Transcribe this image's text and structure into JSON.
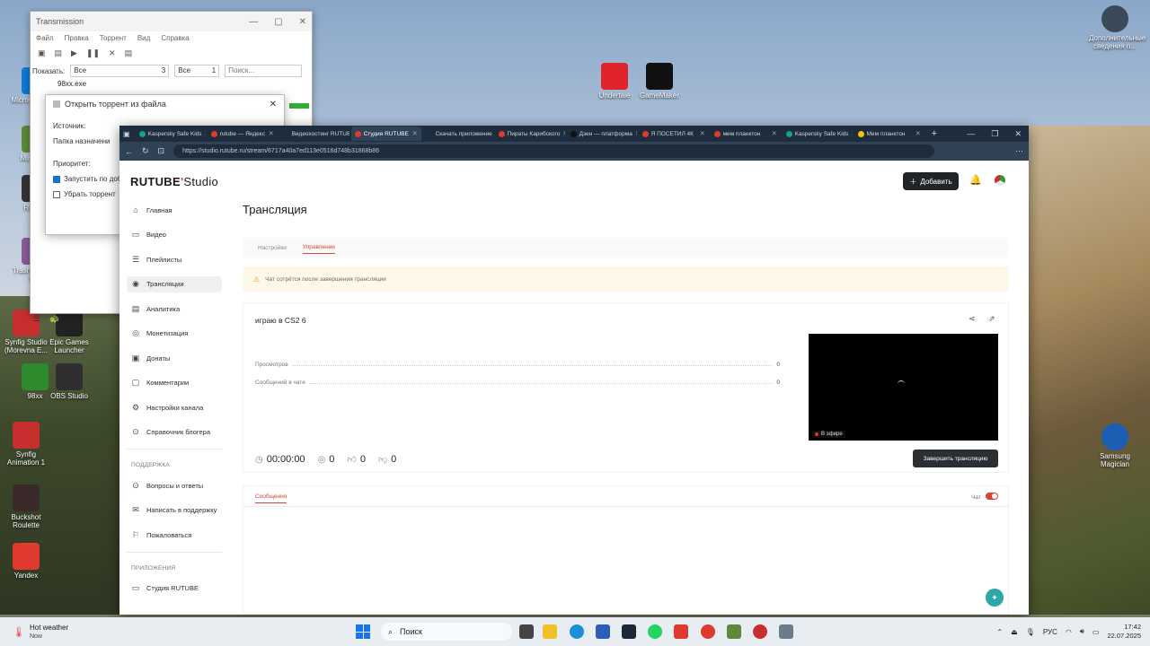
{
  "desktop": {
    "icons_left": [
      {
        "label": "Microsoft Edge",
        "color": "#0c7bd6"
      },
      {
        "label": "Minecraft",
        "color": "#5c8a3a"
      },
      {
        "label": "Roblox",
        "color": "#333333"
      },
      {
        "label": "Trashmatic Of Life",
        "color": "#8a5a9a"
      },
      {
        "label": "Synfig Studio (Morevna E...",
        "color": "#c72f2f"
      },
      {
        "label": "Epic Games Launcher",
        "color": "#222222"
      },
      {
        "label": "98xx",
        "color": "#2d8a2d"
      },
      {
        "label": "OBS Studio",
        "color": "#302e31"
      },
      {
        "label": "Synfig Animation 1",
        "color": "#c72f2f"
      },
      {
        "label": "Buckshot Roulette",
        "color": "#3a2a2a"
      },
      {
        "label": "Yandex",
        "color": "#e03a2f"
      }
    ],
    "icons_top": [
      {
        "label": "Undertale",
        "color": "#e0242b"
      },
      {
        "label": "GameMaker",
        "color": "#111111"
      }
    ],
    "icons_right": [
      {
        "label": "Дополнительные сведения о...",
        "color": "#3b4a5a"
      },
      {
        "label": "Samsung Magician",
        "color": "#1a5fb4"
      }
    ]
  },
  "transmission": {
    "title": "Transmission",
    "menu": [
      "Файл",
      "Правка",
      "Торрент",
      "Вид",
      "Справка"
    ],
    "filter_label": "Показать:",
    "filter1": "Все",
    "filter1_count": "3",
    "filter2": "Все",
    "filter2_count": "1",
    "search_placeholder": "Поиск...",
    "torrent_name": "98xx.exe",
    "dialog": {
      "title": "Открыть торрент из файла",
      "source_label": "Источник:",
      "folder_label": "Папка назначени",
      "priority_label": "Приоритет:",
      "start_label": "Запустить по доб",
      "remove_label": "Убрать торрент"
    }
  },
  "browser": {
    "tabs": [
      {
        "label": "Kaspersky Safe Kids",
        "color": "#16a085",
        "active": false
      },
      {
        "label": "rutube — Яндекс",
        "color": "#e03a2f",
        "active": false
      },
      {
        "label": "Видеохостинг RUTUBE",
        "color": "#1e2d3d",
        "active": false
      },
      {
        "label": "Студия RUTUBE",
        "color": "#e03a2f",
        "active": true
      },
      {
        "label": "Скачать приложение",
        "color": "#1e2d3d",
        "active": false
      },
      {
        "label": "Пираты Карибского",
        "color": "#e03a2f",
        "active": false
      },
      {
        "label": "Дзен — платформа",
        "color": "#111111",
        "active": false
      },
      {
        "label": "Я ПОСЕТИЛ 4К",
        "color": "#e03a2f",
        "active": false
      },
      {
        "label": "мем планктон",
        "color": "#e03a2f",
        "active": false
      },
      {
        "label": "Kaspersky Safe Kids",
        "color": "#16a085",
        "active": false
      },
      {
        "label": "Мем планктон",
        "color": "#f1c40f",
        "active": false
      }
    ],
    "url": "https://studio.rutube.ru/stream/6717a40a7ed113e0516d748b31868b86"
  },
  "studio": {
    "logo_brand": "RUTUBE",
    "logo_suffix": "Studio",
    "add_button": "Добавить",
    "nav": [
      {
        "label": "Главная",
        "icon": "home-icon",
        "glyph": "⌂",
        "active": false
      },
      {
        "label": "Видео",
        "icon": "video-icon",
        "glyph": "▭",
        "active": false
      },
      {
        "label": "Плейлисты",
        "icon": "playlist-icon",
        "glyph": "☰",
        "active": false
      },
      {
        "label": "Трансляции",
        "icon": "broadcast-icon",
        "glyph": "◉",
        "active": true
      },
      {
        "label": "Аналитика",
        "icon": "analytics-icon",
        "glyph": "▤",
        "active": false
      },
      {
        "label": "Монетизация",
        "icon": "monetization-icon",
        "glyph": "◎",
        "active": false
      },
      {
        "label": "Донаты",
        "icon": "donate-icon",
        "glyph": "▣",
        "active": false
      },
      {
        "label": "Комментарии",
        "icon": "comments-icon",
        "glyph": "▢",
        "active": false
      },
      {
        "label": "Настройки канала",
        "icon": "settings-icon",
        "glyph": "⚙",
        "active": false
      },
      {
        "label": "Справочник блогера",
        "icon": "guide-icon",
        "glyph": "⊙",
        "active": false
      }
    ],
    "support_title": "ПОДДЕРЖКА",
    "support_items": [
      {
        "label": "Вопросы и ответы",
        "icon": "faq-icon",
        "glyph": "⊙"
      },
      {
        "label": "Написать в поддержку",
        "icon": "mail-icon",
        "glyph": "✉"
      },
      {
        "label": "Пожаловаться",
        "icon": "flag-icon",
        "glyph": "⚐"
      }
    ],
    "apps_title": "ПРИЛОЖЕНИЯ",
    "apps_items": [
      {
        "label": "Студия RUTUBE",
        "icon": "app-icon",
        "glyph": "▭"
      }
    ],
    "page_title": "Трансляция",
    "subtabs": [
      "Настройки",
      "Управление"
    ],
    "warning": "Чат сотрётся после завершения трансляции",
    "stream_title": "играю в CS2 6",
    "stats": [
      {
        "label": "Просмотров",
        "value": "0"
      },
      {
        "label": "Сообщений в чате",
        "value": "0"
      }
    ],
    "live_label": "В эфире",
    "timer": "00:00:00",
    "viewers": "0",
    "likes": "0",
    "dislikes": "0",
    "end_button": "Завершить трансляцию",
    "chat_tab": "Сообщения",
    "chat_toggle_label": "Чат",
    "accent": "#d8452d"
  },
  "taskbar": {
    "weather_title": "Hot weather",
    "weather_sub": "Now",
    "search": "Поиск",
    "lang": "РУС",
    "time": "17:42",
    "date": "22.07.2025"
  }
}
